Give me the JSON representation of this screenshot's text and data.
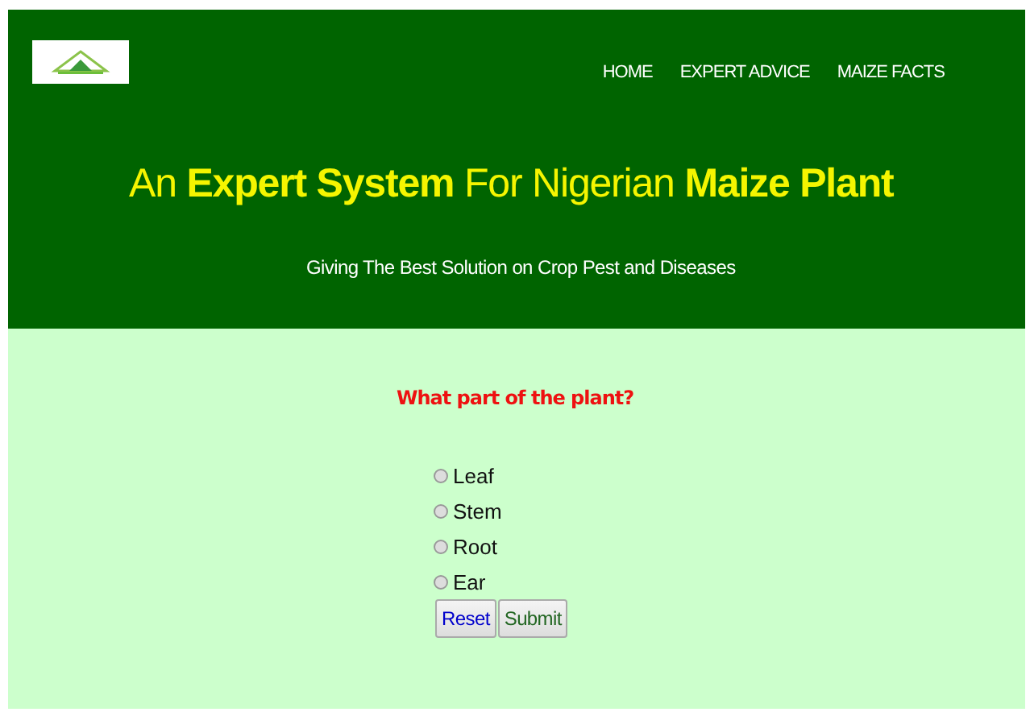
{
  "header": {
    "nav": [
      {
        "label": "HOME"
      },
      {
        "label": "EXPERT ADVICE"
      },
      {
        "label": "MAIZE FACTS"
      }
    ],
    "title": "An **Expert System** For Nigerian **Maize Plant**",
    "subtitle": "Giving The Best Solution on Crop Pest and Diseases"
  },
  "form": {
    "question": "What part of the plant?",
    "options": [
      {
        "label": "Leaf",
        "selected": false
      },
      {
        "label": "Stem",
        "selected": false
      },
      {
        "label": "Root",
        "selected": false
      },
      {
        "label": "Ear",
        "selected": false
      }
    ],
    "buttons": [
      {
        "label": "Reset",
        "kind": "reset"
      },
      {
        "label": "Submit",
        "kind": "submit"
      }
    ]
  }
}
